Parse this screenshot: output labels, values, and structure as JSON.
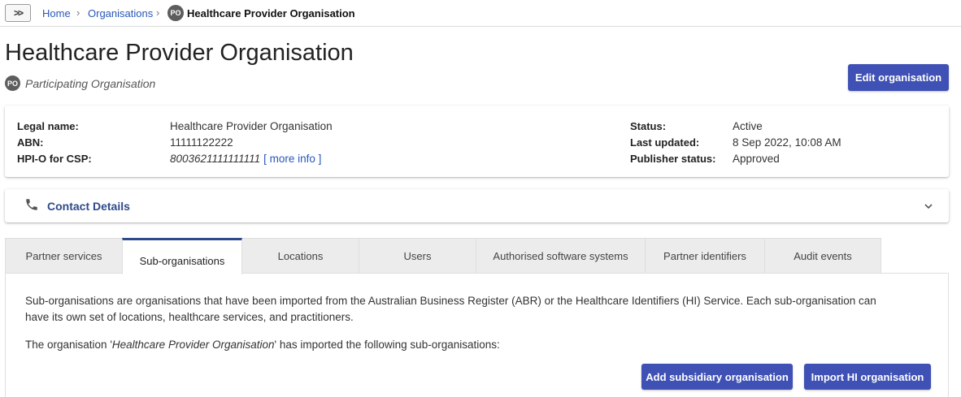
{
  "breadcrumb": {
    "expand_label": ">>",
    "home": "Home",
    "organisations": "Organisations",
    "badge": "PO",
    "current": "Healthcare Provider Organisation"
  },
  "header": {
    "title": "Healthcare Provider Organisation",
    "badge": "PO",
    "subtitle": "Participating Organisation",
    "edit_button": "Edit organisation"
  },
  "summary": {
    "legal_name_label": "Legal name:",
    "legal_name": "Healthcare Provider Organisation",
    "abn_label": "ABN:",
    "abn": "11111122222",
    "hpio_label": "HPI-O for CSP:",
    "hpio": "8003621111111111",
    "more_info": "[ more info ]",
    "status_label": "Status:",
    "status": "Active",
    "last_updated_label": "Last updated:",
    "last_updated": "8 Sep 2022, 10:08 AM",
    "publisher_status_label": "Publisher status:",
    "publisher_status": "Approved"
  },
  "contact": {
    "label": "Contact Details",
    "icon": "phone-icon",
    "expand_icon": "chevron-down-icon"
  },
  "tabs": [
    {
      "label": "Partner services"
    },
    {
      "label": "Sub-organisations"
    },
    {
      "label": "Locations"
    },
    {
      "label": "Users"
    },
    {
      "label": "Authorised software systems"
    },
    {
      "label": "Partner identifiers"
    },
    {
      "label": "Audit events"
    }
  ],
  "active_tab": "Sub-organisations",
  "panel": {
    "intro_line1": "Sub-organisations are organisations that have been imported from the Australian Business Register (ABR) or the Healthcare Identifiers (HI) Service. Each sub-organisation can",
    "intro_line2": "have its own set of locations, healthcare services, and practitioners.",
    "imported_prefix": "The organisation '",
    "imported_org": "Healthcare Provider Organisation",
    "imported_suffix": "' has imported the following sub-organisations:",
    "add_button": "Add subsidiary organisation",
    "import_button": "Import HI organisation"
  },
  "colors": {
    "primary": "#3f51b5",
    "link": "#2857b8",
    "tab_active_border": "#2f4a8a",
    "badge": "#5d5d5d"
  }
}
